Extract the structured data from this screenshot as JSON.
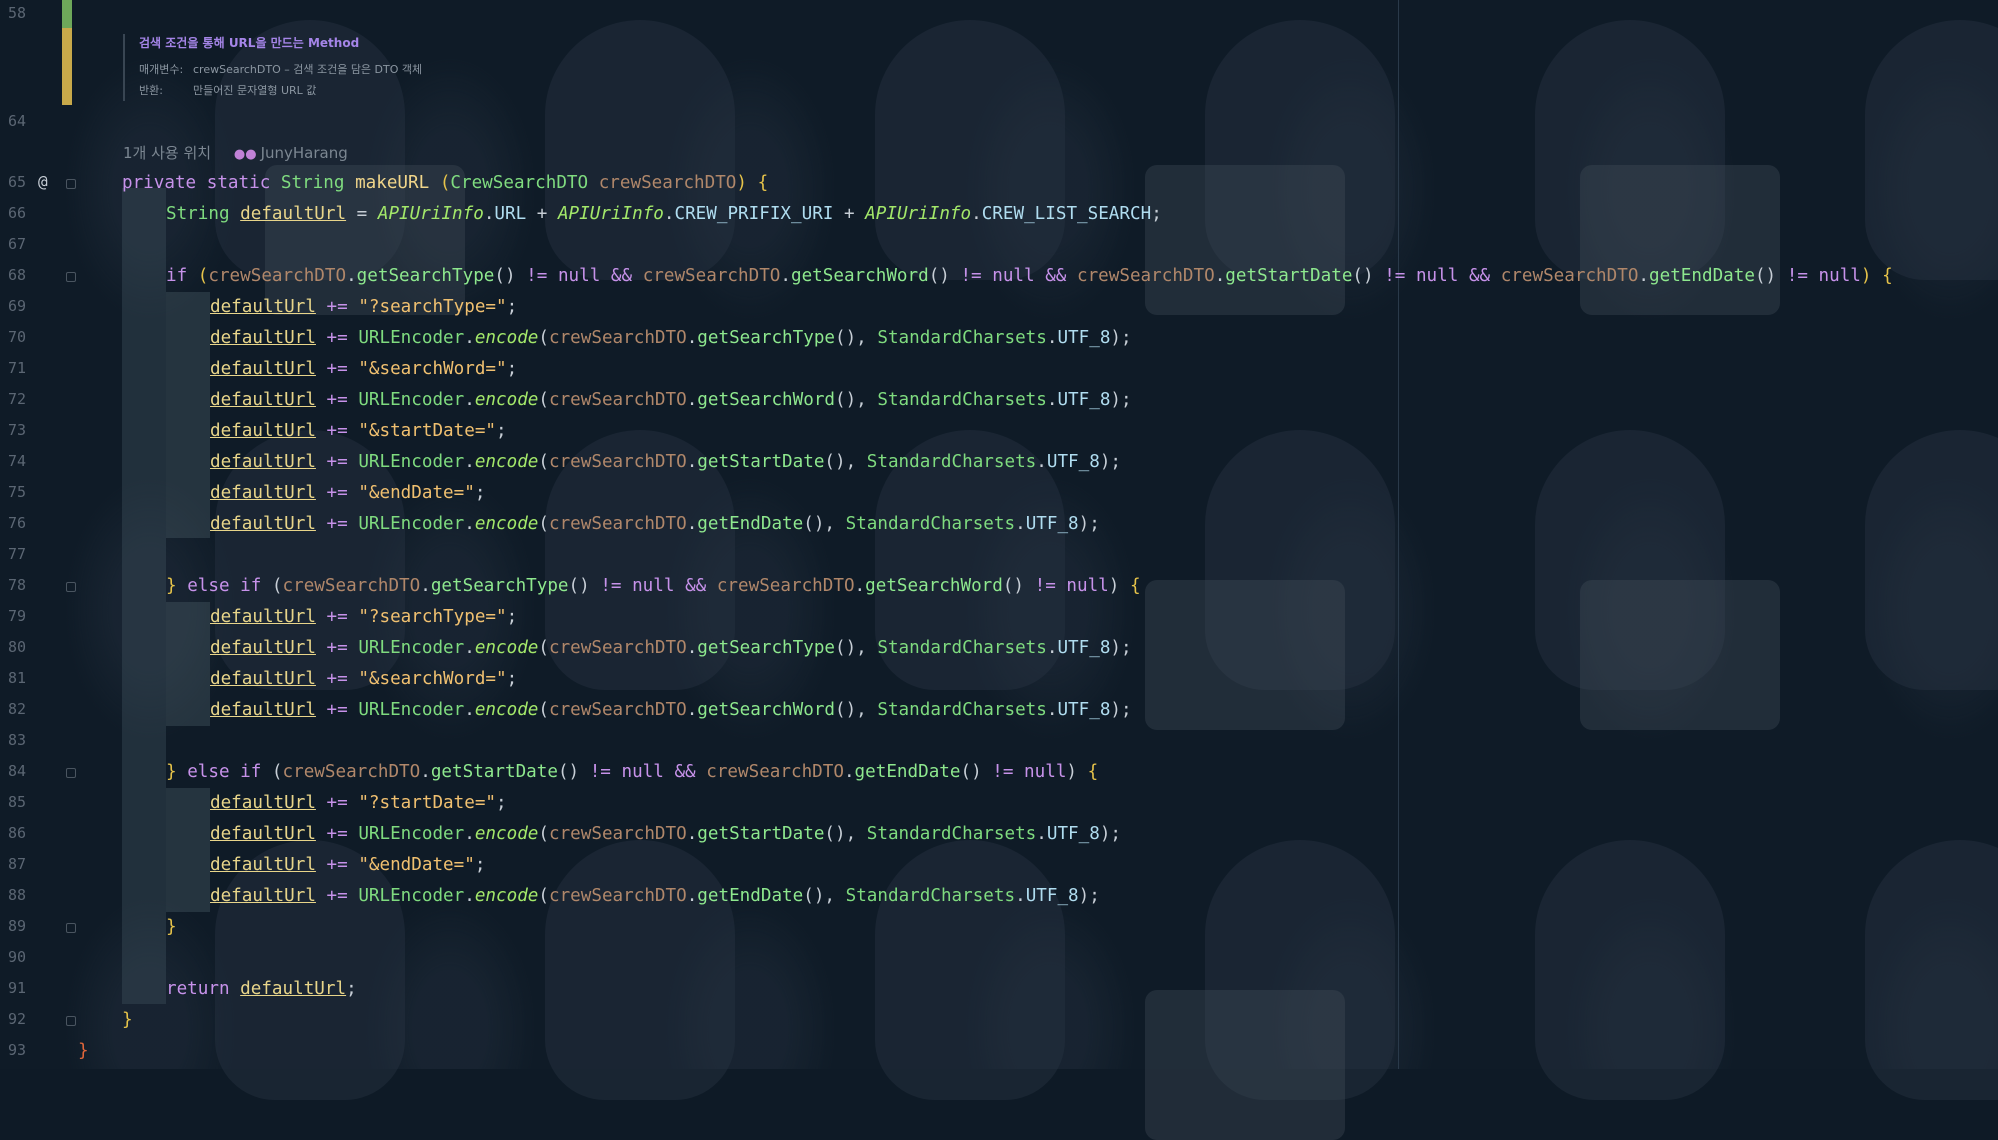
{
  "doc": {
    "title": "검색 조건을 통해 URL을 만드는 Method",
    "param_key": "매개변수:",
    "param_val": "crewSearchDTO – 검색 조건을 담은 DTO 객체",
    "return_key": "반환:",
    "return_val": "만들어진 문자열형 URL 값"
  },
  "hint": {
    "usages": "1개 사용 위치",
    "author": "JunyHarang"
  },
  "lines": [
    "58",
    "64",
    "65",
    "66",
    "67",
    "68",
    "69",
    "70",
    "71",
    "72",
    "73",
    "74",
    "75",
    "76",
    "77",
    "78",
    "79",
    "80",
    "81",
    "82",
    "83",
    "84",
    "85",
    "86",
    "87",
    "88",
    "89",
    "90",
    "91",
    "92",
    "93"
  ],
  "tokens": {
    "private": "private",
    "static": "static",
    "String": "String",
    "makeURL": "makeURL",
    "CrewSearchDTO": "CrewSearchDTO",
    "crewSearchDTO": "crewSearchDTO",
    "defaultUrl": "defaultUrl",
    "APIUriInfo": "APIUriInfo",
    "URL": "URL",
    "CREW_PRIFIX_URI": "CREW_PRIFIX_URI",
    "CREW_LIST_SEARCH": "CREW_LIST_SEARCH",
    "if": "if",
    "else": "else",
    "null": "null",
    "return": "return",
    "getSearchType": "getSearchType",
    "getSearchWord": "getSearchWord",
    "getStartDate": "getStartDate",
    "getEndDate": "getEndDate",
    "URLEncoder": "URLEncoder",
    "encode": "encode",
    "StandardCharsets": "StandardCharsets",
    "UTF_8": "UTF_8",
    "s_searchType": "\"?searchType=\"",
    "s_searchWord": "\"&searchWord=\"",
    "s_startDate": "\"&startDate=\"",
    "s_endDate": "\"&endDate=\"",
    "s_qstartDate": "\"?startDate=\""
  }
}
